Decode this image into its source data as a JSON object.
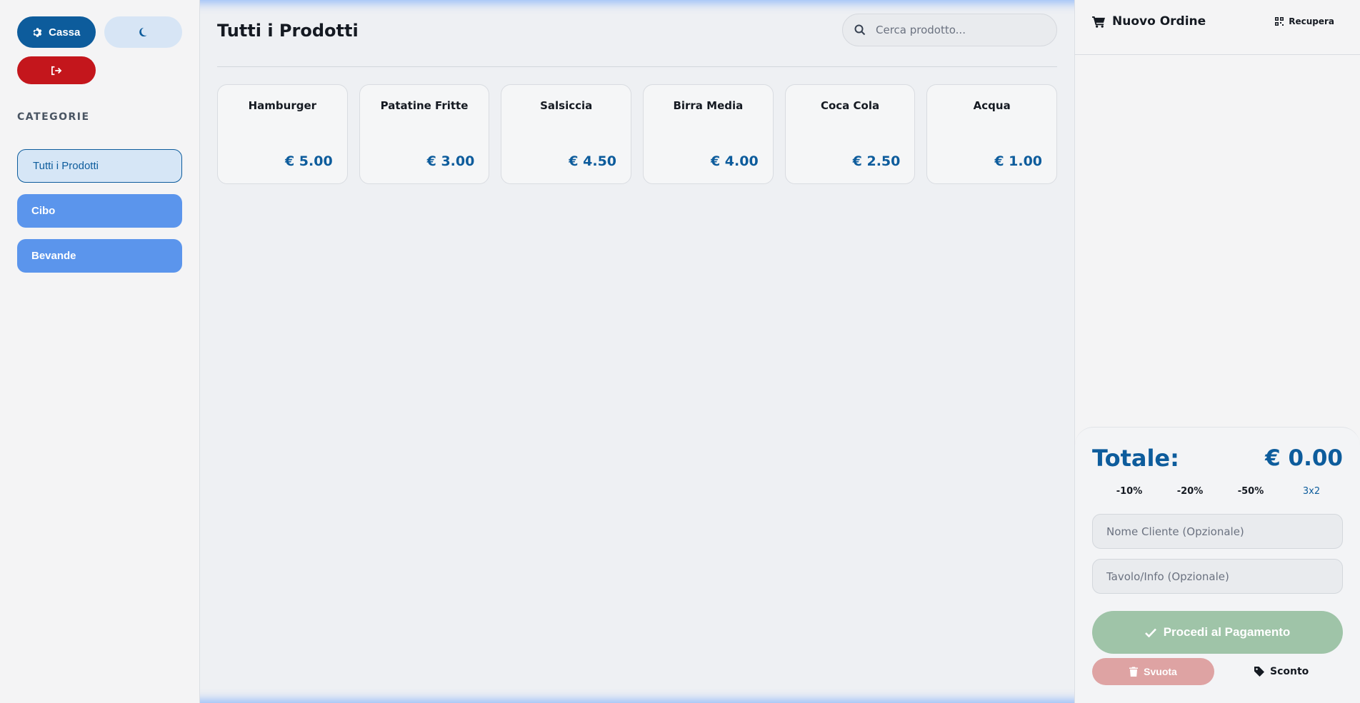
{
  "sidebar": {
    "settings_label": "Cassa",
    "categories_title": "CATEGORIE",
    "categories": [
      {
        "label": "Tutti i Prodotti",
        "active": true
      },
      {
        "label": "Cibo",
        "active": false
      },
      {
        "label": "Bevande",
        "active": false
      }
    ]
  },
  "main": {
    "title": "Tutti i Prodotti",
    "search_placeholder": "Cerca prodotto...",
    "products": [
      {
        "name": "Hamburger",
        "price": "€ 5.00"
      },
      {
        "name": "Patatine Fritte",
        "price": "€ 3.00"
      },
      {
        "name": "Salsiccia",
        "price": "€ 4.50"
      },
      {
        "name": "Birra Media",
        "price": "€ 4.00"
      },
      {
        "name": "Coca Cola",
        "price": "€ 2.50"
      },
      {
        "name": "Acqua",
        "price": "€ 1.00"
      }
    ]
  },
  "order": {
    "title": "Nuovo Ordine",
    "recover_label": "Recupera",
    "total_label": "Totale:",
    "total_value": "€ 0.00",
    "discounts": [
      "-10%",
      "-20%",
      "-50%",
      "3x2"
    ],
    "customer_placeholder": "Nome Cliente (Opzionale)",
    "table_placeholder": "Tavolo/Info (Opzionale)",
    "pay_label": "Procedi al Pagamento",
    "clear_label": "Svuota",
    "discount_label": "Sconto"
  },
  "colors": {
    "primary": "#0d5c9c",
    "category": "#5b95ec",
    "danger": "#c4161c",
    "pay": "#9fc4a8",
    "clear": "#dea3a3"
  },
  "icons": [
    "gear-icon",
    "moon-icon",
    "logout-icon",
    "search-icon",
    "cart-icon",
    "qr-icon",
    "check-icon",
    "trash-icon",
    "tag-icon"
  ]
}
